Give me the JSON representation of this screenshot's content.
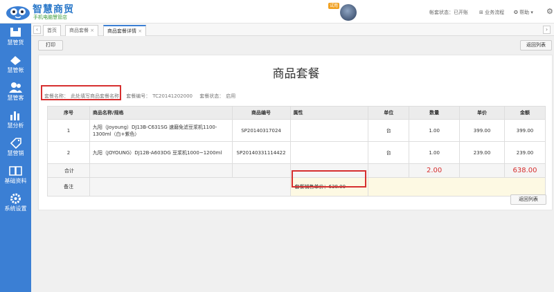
{
  "header": {
    "brand_title": "智慧商贸",
    "brand_subtitle": "手机电脑慧管店",
    "user_badge": "试用",
    "account_status": "帐套状态：已开账",
    "flow_label": "业务流程",
    "help_label": "帮助"
  },
  "sidebar": {
    "items": [
      {
        "label": "慧管货",
        "icon": "goods-icon"
      },
      {
        "label": "慧管帐",
        "icon": "ledger-icon"
      },
      {
        "label": "慧管客",
        "icon": "customers-icon"
      },
      {
        "label": "慧分析",
        "icon": "analytics-icon"
      },
      {
        "label": "慧营销",
        "icon": "marketing-icon"
      },
      {
        "label": "基础资料",
        "icon": "basic-data-icon"
      },
      {
        "label": "系统设置",
        "icon": "system-settings-icon"
      }
    ]
  },
  "tabs": [
    {
      "label": "首页"
    },
    {
      "label": "商品套餐"
    },
    {
      "label": "商品套餐详情"
    }
  ],
  "toolbar": {
    "print_label": "打印",
    "back_label": "返回列表"
  },
  "document": {
    "title": "商品套餐",
    "meta": {
      "name_label": "套餐名称：",
      "name_value": "此处填写商品套餐名称",
      "code_label": "套餐编号：",
      "code_value": "TC20141202000",
      "status_label": "套餐状态：",
      "status_value": "启用"
    },
    "columns": [
      "序号",
      "商品名称/规格",
      "商品编号",
      "属性",
      "单位",
      "数量",
      "单价",
      "金额"
    ],
    "rows": [
      {
        "no": "1",
        "name": "九阳（Joyoung）DJ13B-C631SG 速磨免滤豆浆机1100-1300ml（白+紫色）",
        "code": "SP20140317024",
        "attr": "",
        "unit": "台",
        "qty": "1.00",
        "price": "399.00",
        "amount": "399.00"
      },
      {
        "no": "2",
        "name": "九阳（JOYOUNG）DJ12B-A603DG 豆浆机1000~1200ml",
        "code": "SP20140331114422",
        "attr": "",
        "unit": "台",
        "qty": "1.00",
        "price": "239.00",
        "amount": "239.00"
      }
    ],
    "total_label": "合计",
    "total_qty": "2.00",
    "total_amount": "638.00",
    "note_label": "备注",
    "sale_price_text": "套餐销售单价：638.00"
  },
  "colors": {
    "accent": "#3b7fd4",
    "highlight": "#d62e2e"
  }
}
